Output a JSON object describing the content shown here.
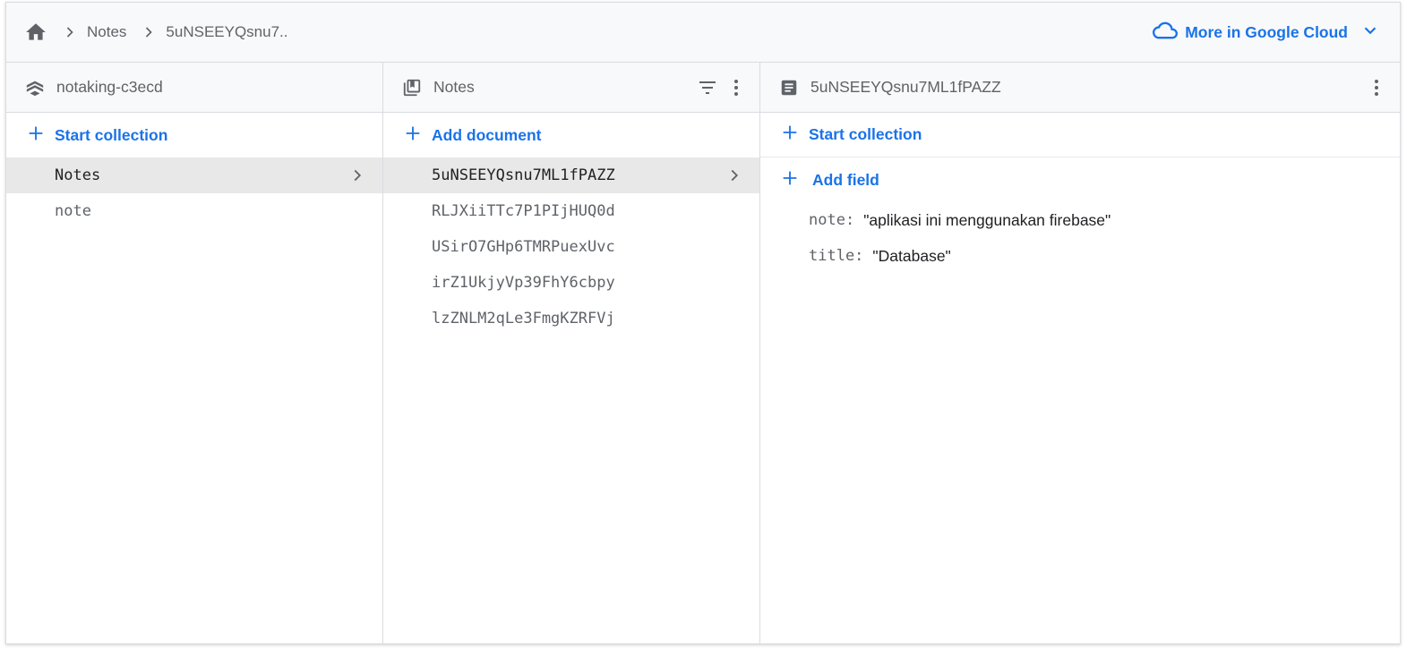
{
  "breadcrumb": {
    "items": [
      "Notes",
      "5uNSEEYQsnu7.."
    ]
  },
  "cloud_link": {
    "label": "More in Google Cloud"
  },
  "panel_root": {
    "title": "notaking-c3ecd",
    "action_label": "Start collection",
    "items": [
      {
        "label": "Notes"
      },
      {
        "label": "note"
      }
    ]
  },
  "panel_collection": {
    "title": "Notes",
    "action_label": "Add document",
    "items": [
      {
        "label": "5uNSEEYQsnu7ML1fPAZZ"
      },
      {
        "label": "RLJXiiTTc7P1PIjHUQ0d"
      },
      {
        "label": "USirO7GHp6TMRPuexUvc"
      },
      {
        "label": "irZ1UkjyVp39FhY6cbpy"
      },
      {
        "label": "lzZNLM2qLe3FmgKZRFVj"
      }
    ]
  },
  "panel_document": {
    "title": "5uNSEEYQsnu7ML1fPAZZ",
    "action_label": "Start collection",
    "add_field_label": "Add field",
    "fields": [
      {
        "key": "note:",
        "value": "\"aplikasi ini menggunakan firebase\""
      },
      {
        "key": "title:",
        "value": "\"Database\""
      }
    ]
  },
  "colors": {
    "accent": "#1a73e8",
    "icon_gray": "#5f6368",
    "selected_bg": "#e8e8e8"
  }
}
